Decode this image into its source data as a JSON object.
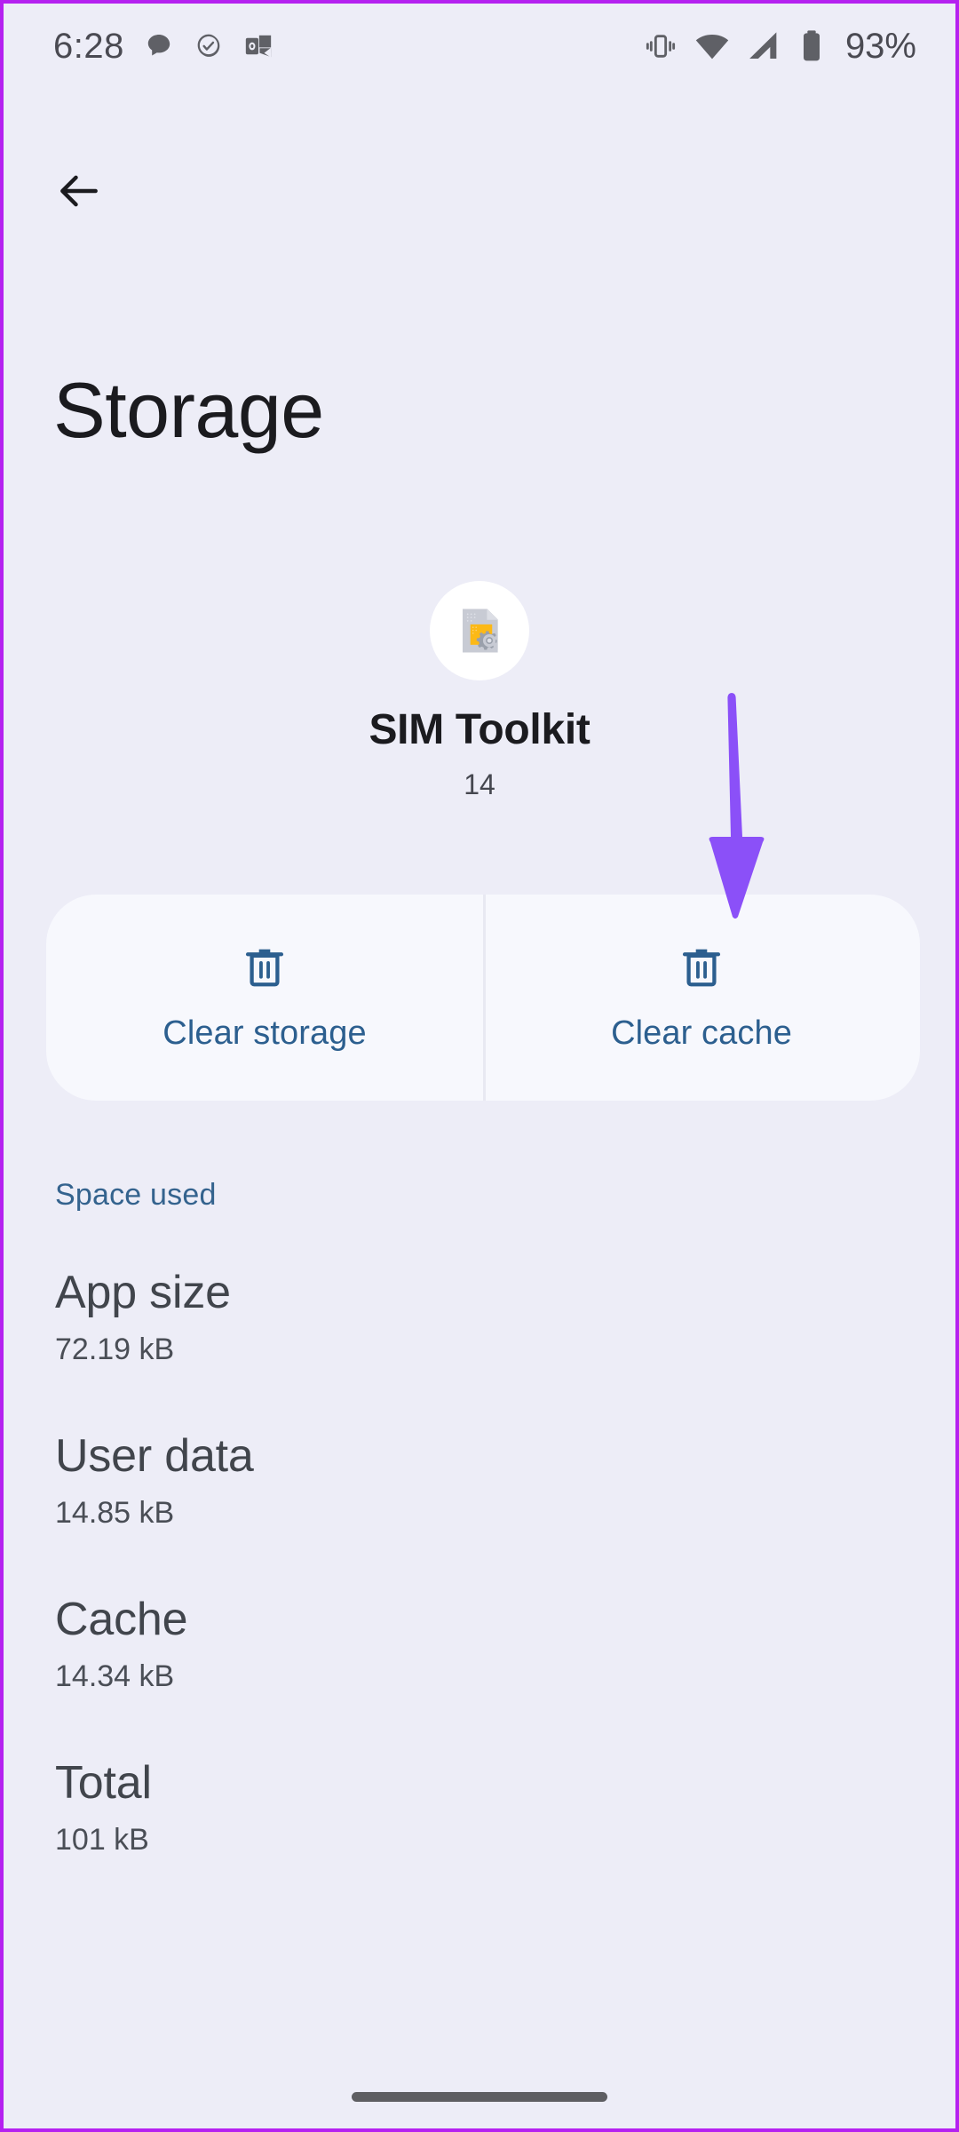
{
  "statusbar": {
    "time": "6:28",
    "battery_percent": "93%",
    "left_icons": [
      "chat-bubble-icon",
      "clock-check-icon",
      "outlook-icon"
    ],
    "right_icons": [
      "vibrate-icon",
      "wifi-icon",
      "signal-icon",
      "battery-icon"
    ]
  },
  "navigation": {
    "back_label": "back-arrow"
  },
  "header": {
    "title": "Storage"
  },
  "app": {
    "icon_name": "sim-toolkit-icon",
    "name": "SIM Toolkit",
    "version": "14"
  },
  "actions": [
    {
      "label": "Clear storage",
      "icon": "trash-icon"
    },
    {
      "label": "Clear cache",
      "icon": "trash-icon"
    }
  ],
  "space_used": {
    "section_label": "Space used",
    "rows": [
      {
        "title": "App size",
        "value": "72.19 kB"
      },
      {
        "title": "User data",
        "value": "14.85 kB"
      },
      {
        "title": "Cache",
        "value": "14.34 kB"
      },
      {
        "title": "Total",
        "value": "101 kB"
      }
    ]
  },
  "annotation": {
    "type": "down-arrow",
    "color": "#8b50f8",
    "points_to": "Clear cache"
  },
  "colors": {
    "background": "#ededf7",
    "card": "#f7f8fd",
    "accent_blue": "#2c5f8f",
    "text_primary": "#1b1b1f",
    "text_secondary": "#4a4e56",
    "frame_border": "#b521f0"
  },
  "system": {
    "gesture_bar": "home-indicator"
  }
}
